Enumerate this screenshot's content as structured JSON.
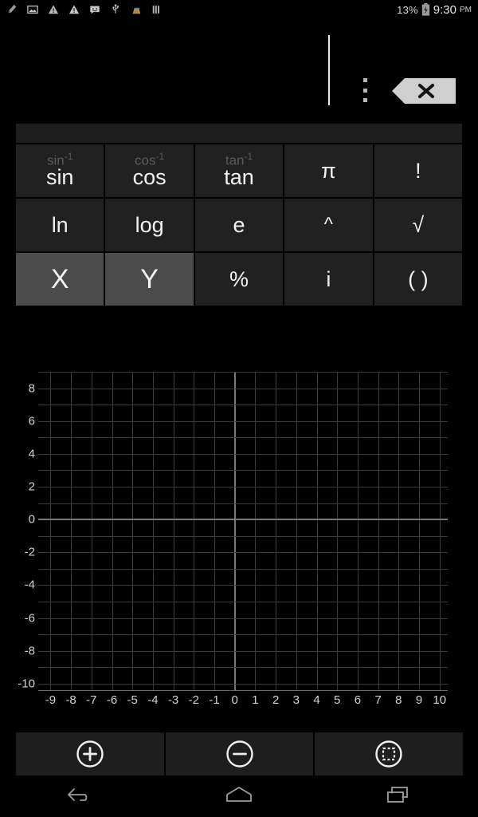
{
  "status_bar": {
    "icons": [
      {
        "name": "cleaner-icon"
      },
      {
        "name": "screenshot-icon"
      },
      {
        "name": "warning-icon"
      },
      {
        "name": "warning-alt-icon"
      },
      {
        "name": "message-smiley-icon"
      },
      {
        "name": "usb-icon"
      },
      {
        "name": "broom-icon"
      },
      {
        "name": "bars-icon"
      }
    ],
    "battery_percent": "13%",
    "battery_state": "charging",
    "time": "9:30",
    "ampm": "PM"
  },
  "display": {
    "expression": "",
    "caret_visible": true,
    "overflow_menu_label": "More options",
    "backspace_label": "Backspace"
  },
  "keypad": {
    "handle_label": "",
    "rows": [
      [
        {
          "label": "sin",
          "sup": "sin",
          "sup_exp": "-1",
          "size": "normal",
          "active": false
        },
        {
          "label": "cos",
          "sup": "cos",
          "sup_exp": "-1",
          "size": "normal",
          "active": false
        },
        {
          "label": "tan",
          "sup": "tan",
          "sup_exp": "-1",
          "size": "normal",
          "active": false
        },
        {
          "label": "π",
          "sup": "",
          "sup_exp": "",
          "size": "normal",
          "active": false
        },
        {
          "label": "!",
          "sup": "",
          "sup_exp": "",
          "size": "normal",
          "active": false
        }
      ],
      [
        {
          "label": "ln",
          "sup": "",
          "sup_exp": "",
          "size": "normal",
          "active": false
        },
        {
          "label": "log",
          "sup": "",
          "sup_exp": "",
          "size": "normal",
          "active": false
        },
        {
          "label": "e",
          "sup": "",
          "sup_exp": "",
          "size": "normal",
          "active": false
        },
        {
          "label": "^",
          "sup": "",
          "sup_exp": "",
          "size": "sym",
          "active": false
        },
        {
          "label": "√",
          "sup": "",
          "sup_exp": "",
          "size": "normal",
          "active": false
        }
      ],
      [
        {
          "label": "X",
          "sup": "",
          "sup_exp": "",
          "size": "big",
          "active": true
        },
        {
          "label": "Y",
          "sup": "",
          "sup_exp": "",
          "size": "big",
          "active": true
        },
        {
          "label": "%",
          "sup": "",
          "sup_exp": "",
          "size": "normal",
          "active": false
        },
        {
          "label": "i",
          "sup": "",
          "sup_exp": "",
          "size": "normal",
          "active": false
        },
        {
          "label": "( )",
          "sup": "",
          "sup_exp": "",
          "size": "normal",
          "active": false
        }
      ]
    ]
  },
  "chart_data": {
    "type": "line",
    "title": "",
    "xlabel": "",
    "ylabel": "",
    "xlim": [
      -9.6,
      10.4
    ],
    "ylim": [
      -10.4,
      9.0
    ],
    "xticks": [
      -9,
      -8,
      -7,
      -6,
      -5,
      -4,
      -3,
      -2,
      -1,
      0,
      1,
      2,
      3,
      4,
      5,
      6,
      7,
      8,
      9,
      10
    ],
    "xtick_labels": [
      "-9",
      "-8",
      "-7",
      "-6",
      "-5",
      "-4",
      "-3",
      "-2",
      "-1",
      "0",
      "1",
      "2",
      "3",
      "4",
      "5",
      "6",
      "7",
      "8",
      "9",
      "10"
    ],
    "yticks": [
      8,
      6,
      4,
      2,
      0,
      -2,
      -4,
      -6,
      -8,
      -10
    ],
    "ytick_labels": [
      "8",
      "6",
      "4",
      "2",
      "0",
      "-2",
      "-4",
      "-6",
      "-8",
      "-10"
    ],
    "grid": true,
    "grid_step": 1,
    "grid_color": "#3a3a3a",
    "axis_color": "#787878",
    "background": "#000000",
    "legend": false,
    "series": [
      {
        "name": "",
        "x": [],
        "y": []
      }
    ]
  },
  "graph_controls": [
    {
      "name": "zoom-in-button",
      "icon": "plus-circle-icon",
      "label": "Zoom in"
    },
    {
      "name": "zoom-out-button",
      "icon": "minus-circle-icon",
      "label": "Zoom out"
    },
    {
      "name": "fit-region-button",
      "icon": "select-region-icon",
      "label": "Fit region"
    }
  ],
  "nav_bar": [
    {
      "name": "nav-back-button",
      "icon": "back-arrow-icon",
      "label": "Back"
    },
    {
      "name": "nav-home-button",
      "icon": "home-icon",
      "label": "Home"
    },
    {
      "name": "nav-recents-button",
      "icon": "recents-icon",
      "label": "Recents"
    }
  ],
  "colors": {
    "background": "#000000",
    "key": "#212121",
    "key_active": "#4b4b4b",
    "key_text": "#f2f2f2",
    "key_sup": "#5b5b5b",
    "accent_light": "#cccccc"
  }
}
